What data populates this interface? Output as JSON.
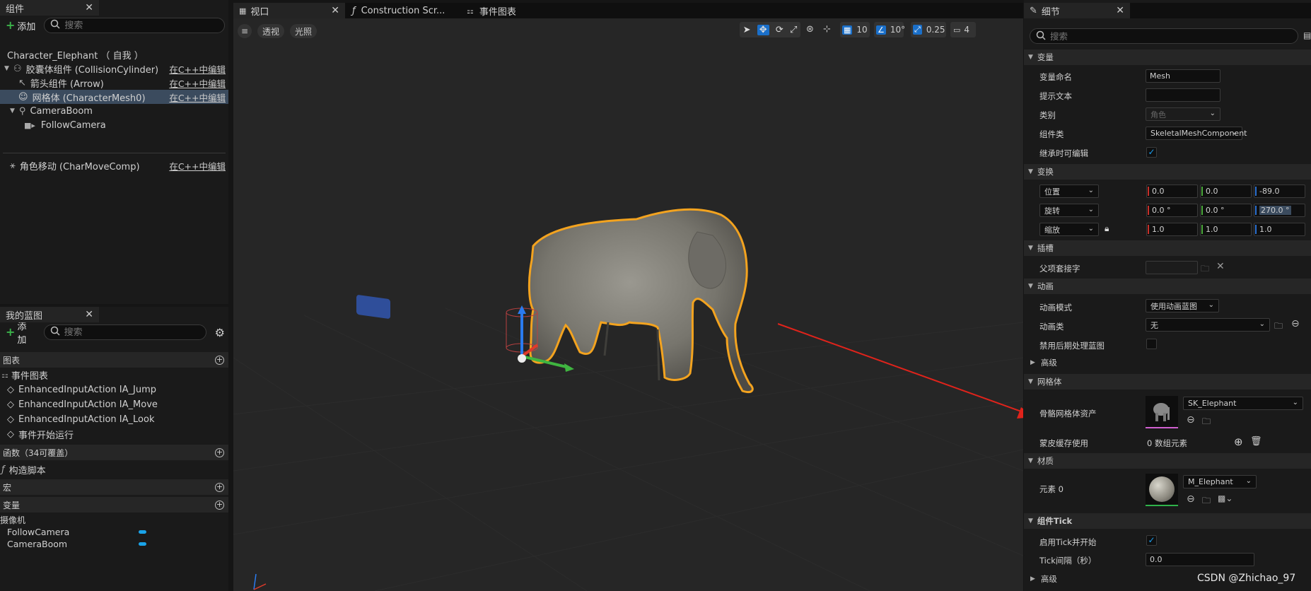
{
  "components": {
    "tab": "组件",
    "add": "添加",
    "search_placeholder": "搜索",
    "tree": [
      {
        "label": "Character_Elephant （ 自我 ）",
        "edit": ""
      },
      {
        "label": "胶囊体组件 (CollisionCylinder)",
        "edit": "在C++中编辑"
      },
      {
        "label": "箭头组件 (Arrow)",
        "edit": "在C++中编辑"
      },
      {
        "label": "网格体 (CharacterMesh0)",
        "edit": "在C++中编辑"
      },
      {
        "label": "CameraBoom",
        "edit": ""
      },
      {
        "label": "FollowCamera",
        "edit": ""
      },
      {
        "label": "角色移动 (CharMoveComp)",
        "edit": "在C++中编辑"
      }
    ]
  },
  "blueprint": {
    "tab": "我的蓝图",
    "add": "添加",
    "search_placeholder": "搜索",
    "graphs_section": "图表",
    "event_graph": "事件图表",
    "events": [
      "EnhancedInputAction IA_Jump",
      "EnhancedInputAction IA_Move",
      "EnhancedInputAction IA_Look",
      "事件开始运行"
    ],
    "functions_section": "函数（34可覆盖）",
    "construction_script": "构造脚本",
    "macros_section": "宏",
    "variables_section": "变量",
    "variable_category": "摄像机",
    "variables": [
      "FollowCamera",
      "CameraBoom"
    ]
  },
  "tabs": {
    "viewport": "视口",
    "construction": "Construction Scr...",
    "event_graph": "事件图表"
  },
  "viewport": {
    "perspective": "透视",
    "lit": "光照",
    "grid_snap": "10",
    "rot_snap": "10°",
    "scale_snap": "0.25",
    "camera_speed": "4"
  },
  "details": {
    "tab": "细节",
    "search_placeholder": "搜索",
    "sections": {
      "variable": "变量",
      "transform": "变换",
      "sockets": "插槽",
      "animation": "动画",
      "advanced": "高级",
      "mesh": "网格体",
      "materials": "材质",
      "component_tick": "组件Tick",
      "advanced2": "高级"
    },
    "labels": {
      "var_name": "变量命名",
      "tooltip": "提示文本",
      "category": "类别",
      "component_class": "组件类",
      "editable_inherit": "继承时可编辑",
      "location": "位置",
      "rotation": "旋转",
      "scale": "缩放",
      "parent_socket": "父项套接字",
      "anim_mode": "动画模式",
      "anim_class": "动画类",
      "disable_post": "禁用后期处理蓝图",
      "skeletal_mesh": "骨骼网格体资产",
      "skin_cache": "蒙皮缓存使用",
      "element0": "元素 0",
      "start_tick": "启用Tick并开始",
      "tick_interval": "Tick间隔（秒）"
    },
    "values": {
      "var_name": "Mesh",
      "tooltip": "",
      "category": "角色",
      "component_class": "SkeletalMeshComponent",
      "location": [
        "0.0",
        "0.0",
        "-89.0"
      ],
      "rotation": [
        "0.0 °",
        "0.0 °",
        "270.0 °"
      ],
      "scale": [
        "1.0",
        "1.0",
        "1.0"
      ],
      "anim_mode": "使用动画蓝图",
      "anim_class": "无",
      "skeletal_mesh": "SK_Elephant",
      "skin_cache": "0 数组元素",
      "material": "M_Elephant",
      "tick_interval": "0.0"
    }
  },
  "watermark": "CSDN @Zhichao_97",
  "colors": {
    "accent": "#1a9ff0",
    "selection": "#f4a623",
    "add_green": "#3bb34a"
  }
}
